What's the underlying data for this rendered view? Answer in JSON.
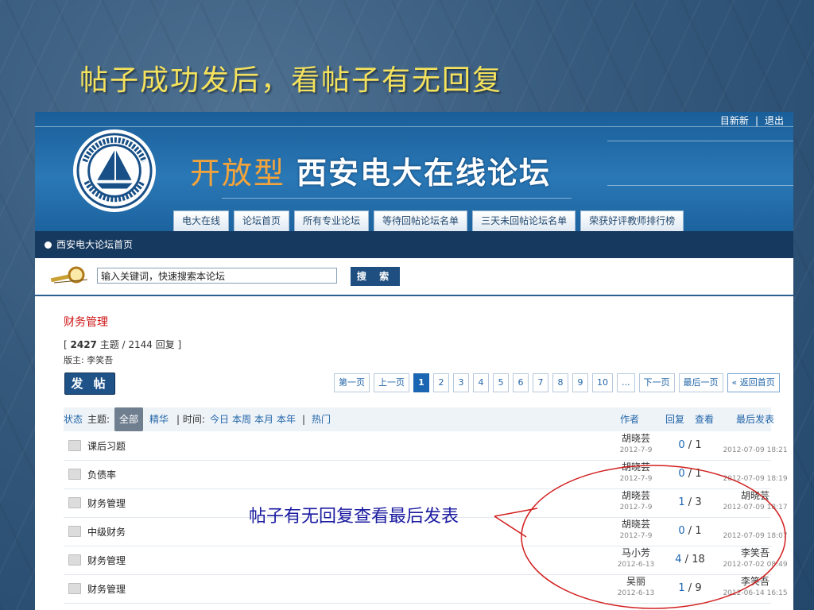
{
  "slide": {
    "title": "帖子成功发后，看帖子有无回复"
  },
  "header": {
    "title_part1": "开放型",
    "title_part2": "西安电大在线论坛",
    "top_links": [
      "目新新",
      "|",
      "退出"
    ]
  },
  "nav": {
    "tabs": [
      "电大在线",
      "论坛首页",
      "所有专业论坛",
      "等待回帖论坛名单",
      "三天未回帖论坛名单",
      "荣获好评教师排行榜"
    ]
  },
  "breadcrumb": "西安电大论坛首页",
  "search": {
    "value": "输入关键词，快速搜索本论坛",
    "button": "搜 索"
  },
  "forum": {
    "name": "财务管理",
    "stats_open": "[ ",
    "topics_count": "2427",
    "stats_rest": " 主题 / 2144 回复 ]",
    "moderator": "版主: 李笑吾",
    "post_button": "发 帖"
  },
  "pager": {
    "first": "第一页",
    "prev": "上一页",
    "pages": [
      "1",
      "2",
      "3",
      "4",
      "5",
      "6",
      "7",
      "8",
      "9",
      "10",
      "..."
    ],
    "next": "下一页",
    "last": "最后一页",
    "home": "« 返回首页"
  },
  "table_header": {
    "status": "状态",
    "topic_label": "主题:",
    "all": "全部",
    "elite": "精华",
    "sep1": "| 时间:",
    "today": "今日",
    "week": "本周",
    "month": "本月",
    "year": "本年",
    "sep2": "|",
    "hot": "热门",
    "author": "作者",
    "replies": "回复",
    "views": "查看",
    "last_post": "最后发表"
  },
  "threads": [
    {
      "title": "课后习题",
      "author": "胡晓芸",
      "date": "2012-7-9",
      "replies": "0",
      "sep": "/",
      "views": "1",
      "last_user": "",
      "last_time": "2012-07-09 18:21"
    },
    {
      "title": "负债率",
      "author": "胡晓芸",
      "date": "2012-7-9",
      "replies": "0",
      "sep": "/",
      "views": "1",
      "last_user": "",
      "last_time": "2012-07-09 18:19"
    },
    {
      "title": "财务管理",
      "author": "胡晓芸",
      "date": "2012-7-9",
      "replies": "1",
      "sep": "/",
      "views": "3",
      "last_user": "胡晓芸",
      "last_time": "2012-07-09 18:17"
    },
    {
      "title": "中级财务",
      "author": "胡晓芸",
      "date": "2012-7-9",
      "replies": "0",
      "sep": "/",
      "views": "1",
      "last_user": "",
      "last_time": "2012-07-09 18:07"
    },
    {
      "title": "财务管理",
      "author": "马小芳",
      "date": "2012-6-13",
      "replies": "4",
      "sep": "/",
      "views": "18",
      "last_user": "李笑吾",
      "last_time": "2012-07-02 08:49"
    },
    {
      "title": "财务管理",
      "author": "吴丽",
      "date": "2012-6-13",
      "replies": "1",
      "sep": "/",
      "views": "9",
      "last_user": "李笑吾",
      "last_time": "2012-06-14 16:15"
    }
  ],
  "annotation": "帖子有无回复查看最后发表",
  "colors": {
    "title_yellow": "#f5e25c",
    "annotation_blue": "#1a1aa0",
    "ellipse_red": "#d21e1e",
    "link_blue": "#2366a8",
    "forum_red": "#cc1111"
  },
  "icons": {
    "logo": "sailboat-seal-logo",
    "search": "magnifier-icon",
    "breadcrumb": "dot-icon",
    "thread": "folder-icon"
  }
}
